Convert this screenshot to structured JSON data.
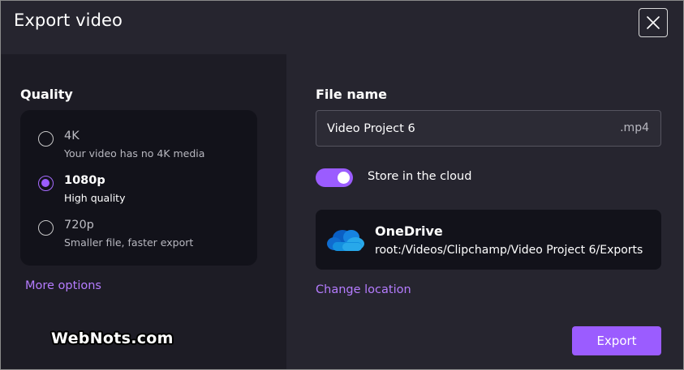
{
  "dialog": {
    "title": "Export video"
  },
  "quality": {
    "label": "Quality",
    "options": [
      {
        "title": "4K",
        "subtitle": "Your video has no 4K media",
        "selected": false
      },
      {
        "title": "1080p",
        "subtitle": "High quality",
        "selected": true
      },
      {
        "title": "720p",
        "subtitle": "Smaller file, faster export",
        "selected": false
      }
    ],
    "more_options": "More options"
  },
  "file": {
    "label": "File name",
    "value": "Video Project 6",
    "extension": ".mp4"
  },
  "cloud": {
    "toggle_label": "Store in the cloud",
    "toggle_on": true,
    "provider": "OneDrive",
    "path": "root:/Videos/Clipchamp/Video Project 6/Exports",
    "change_location": "Change location",
    "icon": "onedrive-cloud-icon"
  },
  "actions": {
    "export_label": "Export"
  },
  "watermark": {
    "text": "WebNots.com"
  },
  "colors": {
    "accent": "#9b5cff",
    "link": "#b57cff",
    "background": "#26252f",
    "panel": "#1d1c25",
    "card": "#12121a"
  }
}
